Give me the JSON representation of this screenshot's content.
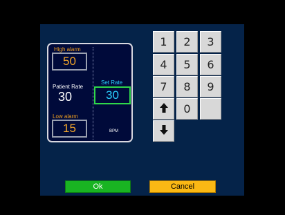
{
  "rate_panel": {
    "high_alarm_label": "High alarm",
    "high_alarm_value": "50",
    "patient_rate_label": "Patient Rate",
    "patient_rate_value": "30",
    "set_rate_label": "Set Rate",
    "set_rate_value": "30",
    "low_alarm_label": "Low alarm",
    "low_alarm_value": "15",
    "unit": "BPM"
  },
  "keypad": {
    "keys": [
      "1",
      "2",
      "3",
      "4",
      "5",
      "6",
      "7",
      "8",
      "9",
      "",
      "0",
      ""
    ],
    "up_icon": "arrow-up-icon",
    "down_icon": "arrow-down-icon"
  },
  "buttons": {
    "ok": "Ok",
    "cancel": "Cancel"
  },
  "colors": {
    "ok": "#19b422",
    "cancel": "#fab814",
    "set_rate_border": "#2fd84a",
    "alarm_text": "#f2a52a"
  }
}
